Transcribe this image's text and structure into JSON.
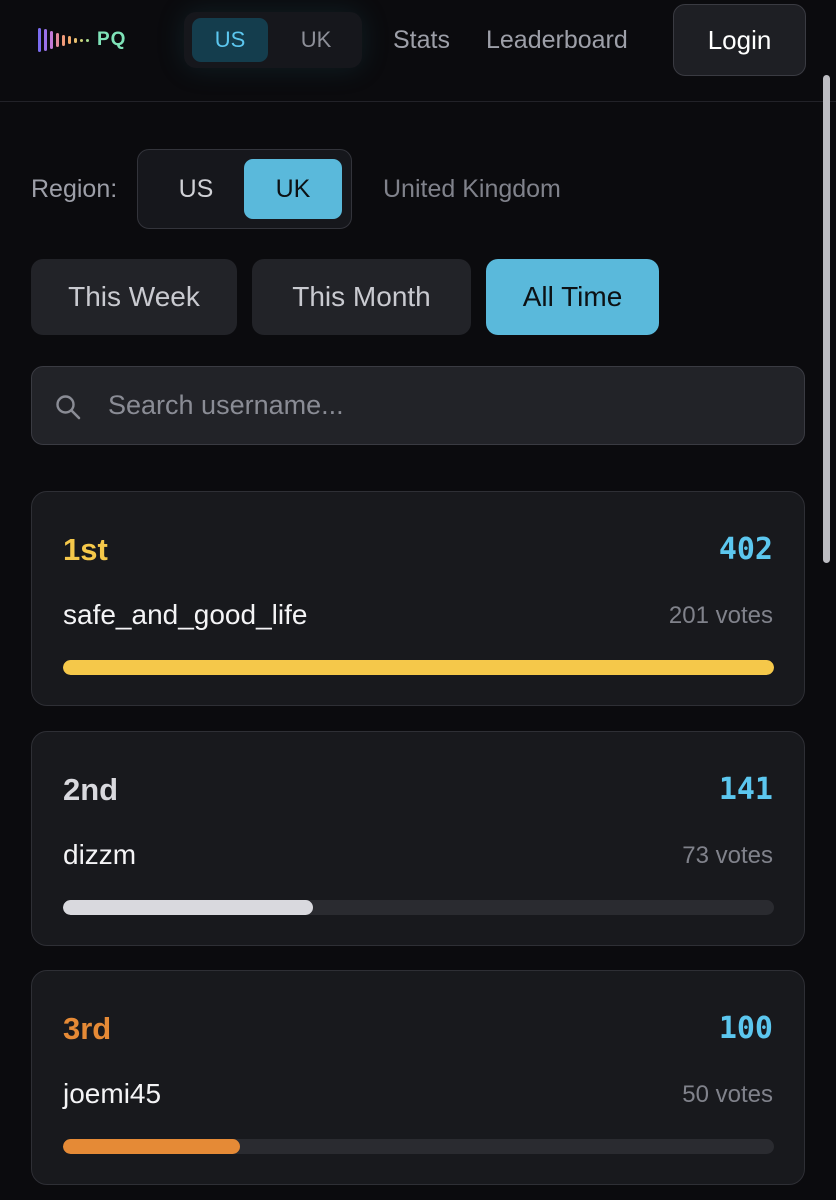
{
  "nav": {
    "logo_text": "PQ",
    "region_options": [
      "US",
      "UK"
    ],
    "region_selected": "US",
    "links": [
      "Stats",
      "Leaderboard"
    ],
    "login_label": "Login"
  },
  "filters": {
    "region_label": "Region:",
    "region_options": [
      "US",
      "UK"
    ],
    "region_selected": "UK",
    "region_name": "United Kingdom",
    "time_tabs": [
      "This Week",
      "This Month",
      "All Time"
    ],
    "time_selected": "All Time"
  },
  "search": {
    "placeholder": "Search username...",
    "value": ""
  },
  "leaderboard": [
    {
      "rank": "1st",
      "score": "402",
      "username": "safe_and_good_life",
      "votes": "201 votes",
      "progress": 1.0,
      "color": "#f5c84a"
    },
    {
      "rank": "2nd",
      "score": "141",
      "username": "dizzm",
      "votes": "73 votes",
      "progress": 0.351,
      "color": "#d9d9de"
    },
    {
      "rank": "3rd",
      "score": "100",
      "username": "joemi45",
      "votes": "50 votes",
      "progress": 0.249,
      "color": "#e58a36"
    }
  ],
  "colors": {
    "accent": "#5ab9db",
    "score": "#5cc7ef",
    "gold": "#f5c84a",
    "silver": "#d9d9de",
    "bronze": "#e58a36"
  }
}
